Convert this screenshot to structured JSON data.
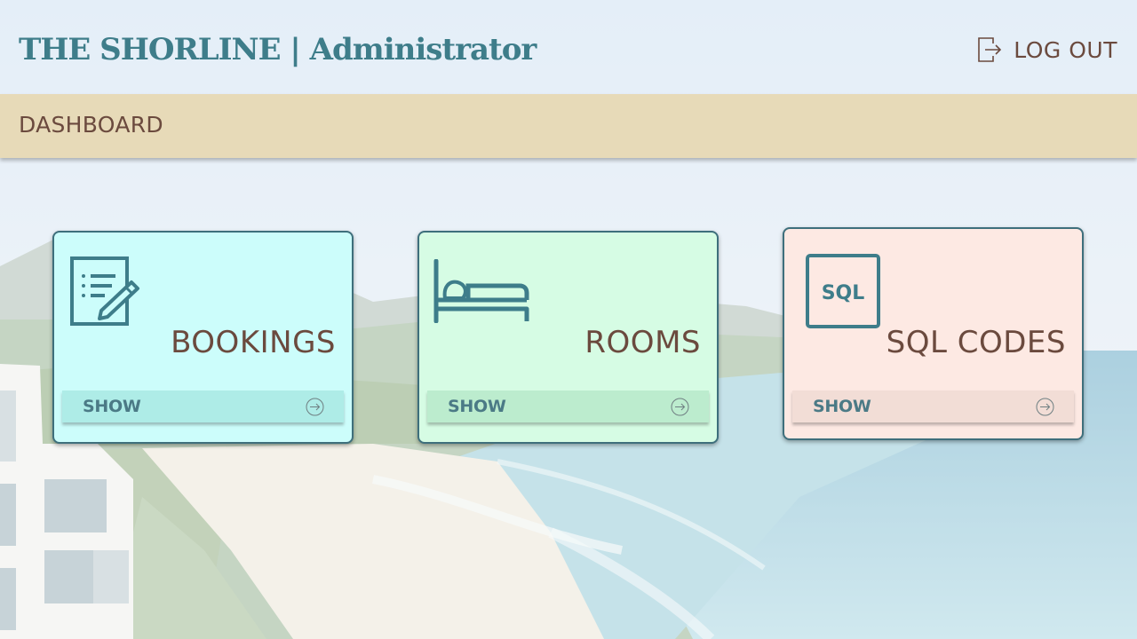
{
  "header": {
    "app_title": "THE SHORLINE | Administrator",
    "logout_label": "LOG OUT",
    "logout_icon": "logout-icon"
  },
  "dashboard": {
    "title": "DASHBOARD"
  },
  "cards": [
    {
      "id": "bookings",
      "title": "BOOKINGS",
      "icon": "document-edit-icon",
      "button_label": "SHOW",
      "background": "#ccfdfb",
      "button_background": "#aeece7"
    },
    {
      "id": "rooms",
      "title": "ROOMS",
      "icon": "bed-icon",
      "button_label": "SHOW",
      "background": "#d6fce4",
      "button_background": "#bcecce"
    },
    {
      "id": "sql",
      "title": "SQL CODES",
      "icon_text": "SQL",
      "icon": "sql-icon",
      "button_label": "SHOW",
      "background": "#fde9e3",
      "button_background": "#f2ddd6"
    }
  ],
  "colors": {
    "accent_teal": "#3e7d8a",
    "text_brown": "#6b4a3e",
    "band": "#e7dab8"
  }
}
